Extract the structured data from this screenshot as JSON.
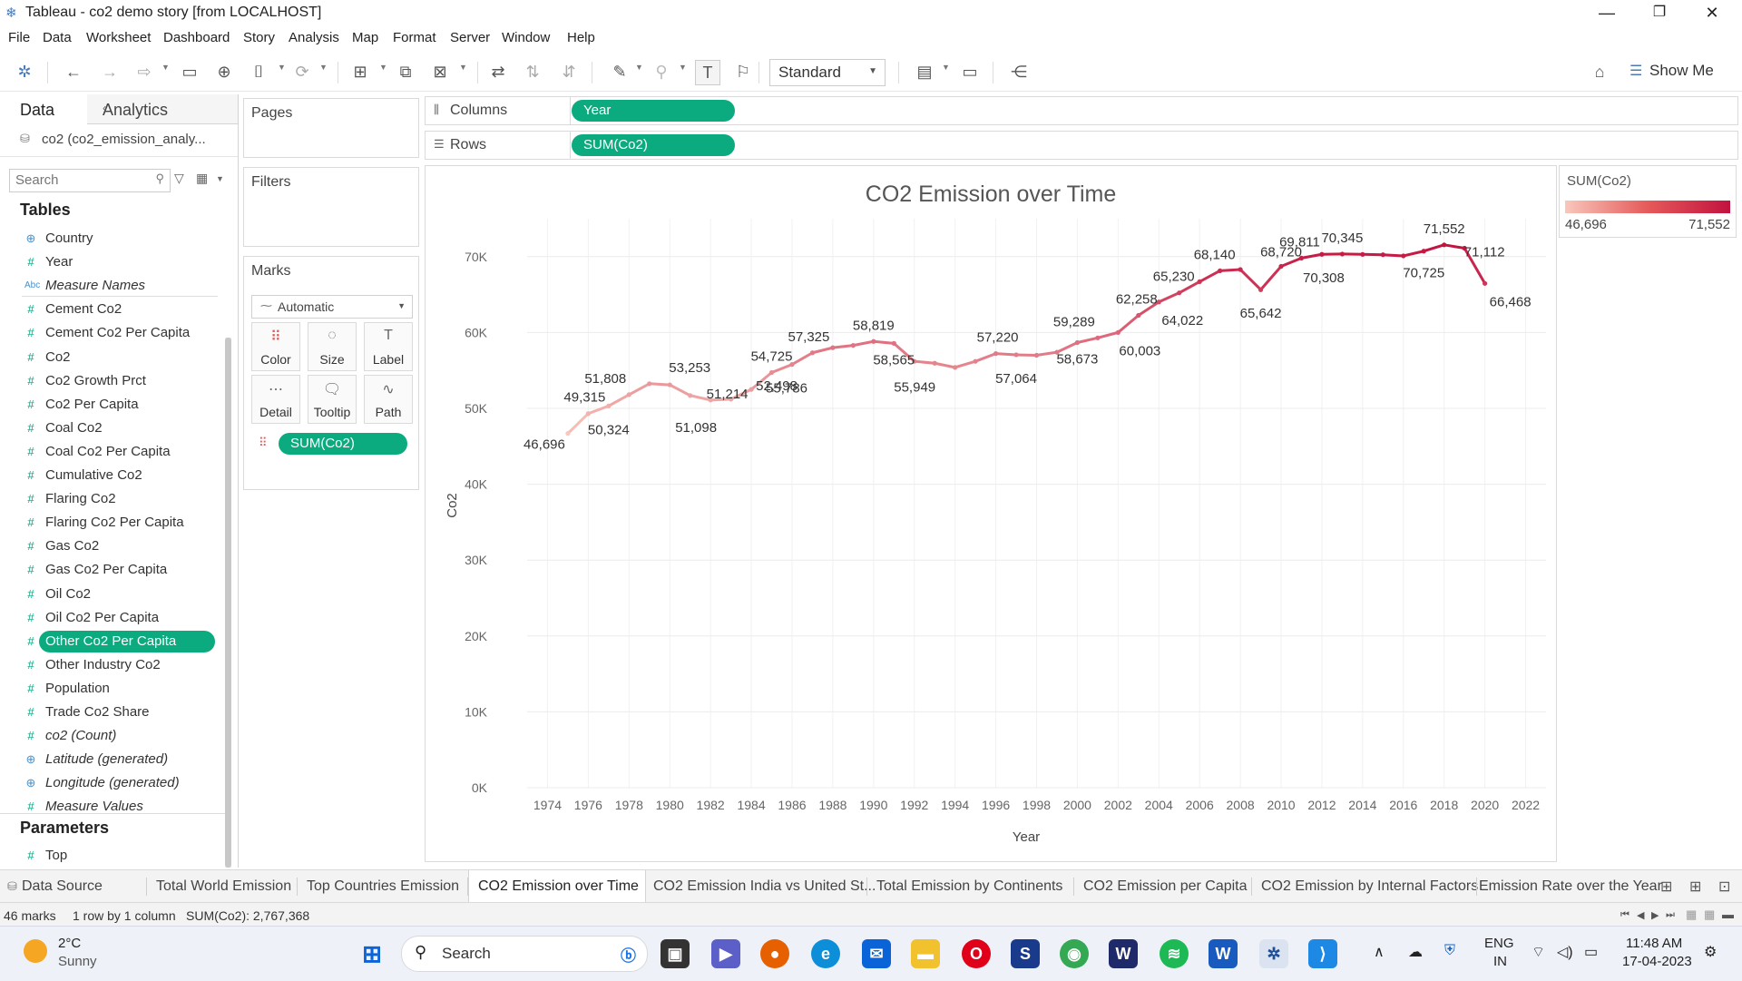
{
  "window": {
    "title": "Tableau - co2 demo story [from LOCALHOST]",
    "minimize": "—",
    "restore": "❐",
    "close": "✕"
  },
  "menu": [
    "File",
    "Data",
    "Worksheet",
    "Dashboard",
    "Story",
    "Analysis",
    "Map",
    "Format",
    "Server",
    "Window",
    "Help"
  ],
  "toolbar": {
    "fit_value": "Standard",
    "show_me_label": "Show Me"
  },
  "data_pane": {
    "tab_data": "Data",
    "tab_analytics": "Analytics",
    "datasource_label": "co2 (co2_emission_analy...",
    "search_placeholder": "Search",
    "tables_heading": "Tables",
    "fields": [
      {
        "name": "Country",
        "type": "geo",
        "style": "normal"
      },
      {
        "name": "Year",
        "type": "measure",
        "style": "normal"
      },
      {
        "name": "Measure Names",
        "type": "abc",
        "style": "italic"
      },
      {
        "name": "Cement Co2",
        "type": "measure",
        "style": "normal"
      },
      {
        "name": "Cement Co2 Per Capita",
        "type": "measure",
        "style": "normal"
      },
      {
        "name": "Co2",
        "type": "measure",
        "style": "normal"
      },
      {
        "name": "Co2 Growth Prct",
        "type": "measure",
        "style": "normal"
      },
      {
        "name": "Co2 Per Capita",
        "type": "measure",
        "style": "normal"
      },
      {
        "name": "Coal Co2",
        "type": "measure",
        "style": "normal"
      },
      {
        "name": "Coal Co2 Per Capita",
        "type": "measure",
        "style": "normal"
      },
      {
        "name": "Cumulative Co2",
        "type": "measure",
        "style": "normal"
      },
      {
        "name": "Flaring Co2",
        "type": "measure",
        "style": "normal"
      },
      {
        "name": "Flaring Co2 Per Capita",
        "type": "measure",
        "style": "normal"
      },
      {
        "name": "Gas Co2",
        "type": "measure",
        "style": "normal"
      },
      {
        "name": "Gas Co2 Per Capita",
        "type": "measure",
        "style": "normal"
      },
      {
        "name": "Oil Co2",
        "type": "measure",
        "style": "normal"
      },
      {
        "name": "Oil Co2 Per Capita",
        "type": "measure",
        "style": "normal"
      },
      {
        "name": "Other Co2 Per Capita",
        "type": "measure",
        "style": "selected"
      },
      {
        "name": "Other Industry Co2",
        "type": "measure",
        "style": "normal"
      },
      {
        "name": "Population",
        "type": "measure",
        "style": "normal"
      },
      {
        "name": "Trade Co2 Share",
        "type": "measure",
        "style": "normal"
      },
      {
        "name": "co2 (Count)",
        "type": "measure",
        "style": "italic"
      },
      {
        "name": "Latitude (generated)",
        "type": "geo",
        "style": "italic"
      },
      {
        "name": "Longitude (generated)",
        "type": "geo",
        "style": "italic"
      },
      {
        "name": "Measure Values",
        "type": "measure",
        "style": "italic"
      }
    ],
    "parameters_heading": "Parameters",
    "parameters": [
      {
        "name": "Top",
        "type": "measure",
        "style": "normal"
      }
    ]
  },
  "shelves": {
    "pages_label": "Pages",
    "filters_label": "Filters",
    "marks_label": "Marks",
    "mark_type": "Automatic",
    "mark_buttons": [
      {
        "label": "Color",
        "icon": "⠿"
      },
      {
        "label": "Size",
        "icon": "◌"
      },
      {
        "label": "Label",
        "icon": "T"
      },
      {
        "label": "Detail",
        "icon": "⋯"
      },
      {
        "label": "Tooltip",
        "icon": "🗨"
      },
      {
        "label": "Path",
        "icon": "∿"
      }
    ],
    "marks_pill": "SUM(Co2)",
    "columns_label": "Columns",
    "columns_pill": "Year",
    "rows_label": "Rows",
    "rows_pill": "SUM(Co2)"
  },
  "legend": {
    "title": "SUM(Co2)",
    "min_label": "46,696",
    "max_label": "71,552",
    "color_low": "#f9c7bc",
    "color_high": "#c2123f"
  },
  "chart_data": {
    "type": "line",
    "title": "CO2 Emission over Time",
    "xlabel": "Year",
    "ylabel": "Co2",
    "xlim": [
      1973,
      2023
    ],
    "ylim": [
      0,
      75000
    ],
    "x_ticks": [
      1974,
      1976,
      1978,
      1980,
      1982,
      1984,
      1986,
      1988,
      1990,
      1992,
      1994,
      1996,
      1998,
      2000,
      2002,
      2004,
      2006,
      2008,
      2010,
      2012,
      2014,
      2016,
      2018,
      2020,
      2022
    ],
    "y_ticks": [
      0,
      10000,
      20000,
      30000,
      40000,
      50000,
      60000,
      70000
    ],
    "y_tick_labels": [
      "0K",
      "10K",
      "20K",
      "30K",
      "40K",
      "50K",
      "60K",
      "70K"
    ],
    "grid": true,
    "color_low": "#f9c7bc",
    "color_high": "#c2123f",
    "series": [
      {
        "x": [
          1975,
          1976,
          1977,
          1978,
          1979,
          1980,
          1981,
          1982,
          1983,
          1984,
          1985,
          1986,
          1987,
          1988,
          1989,
          1990,
          1991,
          1992,
          1993,
          1994,
          1995,
          1996,
          1997,
          1998,
          1999,
          2000,
          2001,
          2002,
          2003,
          2004,
          2005,
          2006,
          2007,
          2008,
          2009,
          2010,
          2011,
          2012,
          2013,
          2014,
          2015,
          2016,
          2017,
          2018,
          2019,
          2020
        ],
        "y": [
          46696,
          49315,
          50324,
          51808,
          53253,
          53100,
          51700,
          51098,
          51214,
          52498,
          54725,
          55786,
          57325,
          58000,
          58300,
          58819,
          58565,
          56200,
          55949,
          55400,
          56200,
          57220,
          57064,
          57000,
          57400,
          58673,
          59289,
          60003,
          62258,
          64022,
          65230,
          66700,
          68140,
          68300,
          65642,
          68720,
          69811,
          70308,
          70345,
          70300,
          70250,
          70100,
          70725,
          71552,
          71112,
          66468
        ],
        "labels": [
          {
            "x": 1975,
            "y": 46696,
            "text": "46,696"
          },
          {
            "x": 1976,
            "y": 49315,
            "text": "49,315"
          },
          {
            "x": 1977,
            "y": 50324,
            "text": "50,324"
          },
          {
            "x": 1978,
            "y": 51808,
            "text": "51,808"
          },
          {
            "x": 1980,
            "y": 53253,
            "text": "53,253"
          },
          {
            "x": 1982,
            "y": 51098,
            "text": "51,098"
          },
          {
            "x": 1983,
            "y": 51214,
            "text": "51,214"
          },
          {
            "x": 1984,
            "y": 52498,
            "text": "52,498"
          },
          {
            "x": 1985,
            "y": 54725,
            "text": "54,725"
          },
          {
            "x": 1986,
            "y": 55786,
            "text": "55,786"
          },
          {
            "x": 1987,
            "y": 57325,
            "text": "57,325"
          },
          {
            "x": 1990,
            "y": 58819,
            "text": "58,819"
          },
          {
            "x": 1991,
            "y": 58565,
            "text": "58,565"
          },
          {
            "x": 1993,
            "y": 55949,
            "text": "55,949"
          },
          {
            "x": 1996,
            "y": 57220,
            "text": "57,220"
          },
          {
            "x": 1997,
            "y": 57064,
            "text": "57,064"
          },
          {
            "x": 2000,
            "y": 58673,
            "text": "58,673"
          },
          {
            "x": 2001,
            "y": 59289,
            "text": "59,289"
          },
          {
            "x": 2002,
            "y": 60003,
            "text": "60,003"
          },
          {
            "x": 2003,
            "y": 62258,
            "text": "62,258"
          },
          {
            "x": 2004,
            "y": 64022,
            "text": "64,022"
          },
          {
            "x": 2005,
            "y": 65230,
            "text": "65,230"
          },
          {
            "x": 2007,
            "y": 68140,
            "text": "68,140"
          },
          {
            "x": 2009,
            "y": 65642,
            "text": "65,642"
          },
          {
            "x": 2010,
            "y": 68720,
            "text": "68,720"
          },
          {
            "x": 2011,
            "y": 69811,
            "text": "69,811"
          },
          {
            "x": 2012,
            "y": 70308,
            "text": "70,308"
          },
          {
            "x": 2013,
            "y": 70345,
            "text": "70,345"
          },
          {
            "x": 2017,
            "y": 70725,
            "text": "70,725"
          },
          {
            "x": 2018,
            "y": 71552,
            "text": "71,552"
          },
          {
            "x": 2019,
            "y": 71112,
            "text": "71,112"
          },
          {
            "x": 2020,
            "y": 66468,
            "text": "66,468"
          }
        ]
      }
    ]
  },
  "sheet_tabs": [
    {
      "label": "Data Source",
      "icon": "⛁",
      "active": false
    },
    {
      "label": "Total World Emission",
      "active": false
    },
    {
      "label": "Top Countries Emission",
      "active": false
    },
    {
      "label": "CO2 Emission over Time",
      "active": true
    },
    {
      "label": "CO2 Emission India vs United St...",
      "active": false
    },
    {
      "label": "Total Emission by Continents",
      "active": false
    },
    {
      "label": "CO2 Emission per Capita",
      "active": false
    },
    {
      "label": "CO2 Emission by Internal Factors",
      "active": false
    },
    {
      "label": "Emission Rate over the Year",
      "active": false
    }
  ],
  "status": {
    "marks": "46 marks",
    "dims": "1 row by 1 column",
    "sum": "SUM(Co2): 2,767,368"
  },
  "taskbar": {
    "weather_temp": "2°C",
    "weather_desc": "Sunny",
    "search_label": "Search",
    "lang_top": "ENG",
    "lang_bottom": "IN",
    "time": "11:48 AM",
    "date": "17-04-2023"
  }
}
